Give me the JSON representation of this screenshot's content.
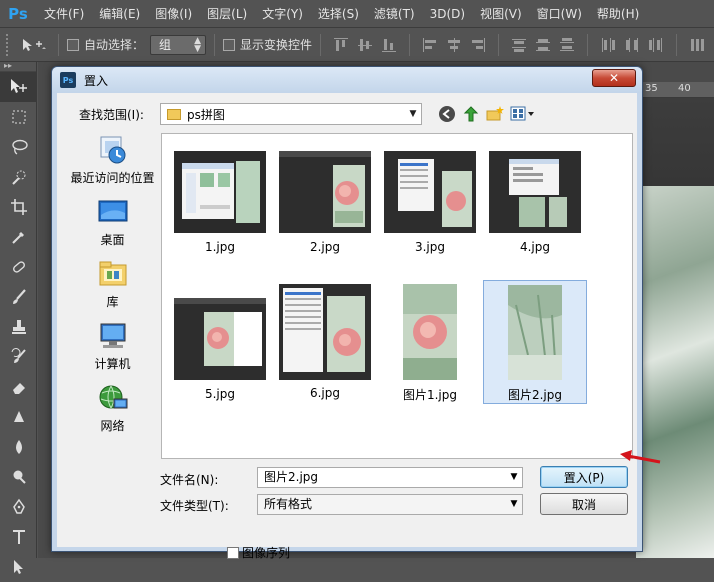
{
  "app": {
    "logo": "Ps",
    "menu": [
      "文件(F)",
      "编辑(E)",
      "图像(I)",
      "图层(L)",
      "文字(Y)",
      "选择(S)",
      "滤镜(T)",
      "3D(D)",
      "视图(V)",
      "窗口(W)",
      "帮助(H)"
    ]
  },
  "options": {
    "auto_select_label": "自动选择：",
    "auto_select_value": "组",
    "show_transform_label": "显示变换控件"
  },
  "ruler": {
    "tick_35": "35",
    "tick_40": "40"
  },
  "dialog": {
    "title": "置入",
    "icon_text": "Ps",
    "lookin_label": "查找范围(I):",
    "lookin_value": "ps拼图",
    "places": [
      {
        "label": "最近访问的位置",
        "icon": "recent-places-icon"
      },
      {
        "label": "桌面",
        "icon": "desktop-icon"
      },
      {
        "label": "库",
        "icon": "libraries-icon"
      },
      {
        "label": "计算机",
        "icon": "computer-icon"
      },
      {
        "label": "网络",
        "icon": "network-icon"
      }
    ],
    "files": [
      {
        "name": "1.jpg"
      },
      {
        "name": "2.jpg"
      },
      {
        "name": "3.jpg"
      },
      {
        "name": "4.jpg"
      },
      {
        "name": "5.jpg"
      },
      {
        "name": "6.jpg"
      },
      {
        "name": "图片1.jpg"
      },
      {
        "name": "图片2.jpg",
        "selected": true
      }
    ],
    "filename_label": "文件名(N):",
    "filename_value": "图片2.jpg",
    "filetype_label": "文件类型(T):",
    "filetype_value": "所有格式",
    "place_button": "置入(P)",
    "cancel_button": "取消",
    "image_sequence_label": "图像序列"
  }
}
